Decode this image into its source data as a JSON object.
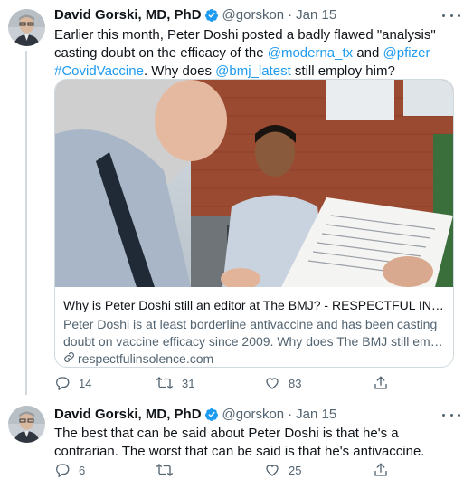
{
  "tweets": [
    {
      "author_name": "David Gorski, MD, PhD",
      "handle": "@gorskon",
      "separator": "·",
      "date": "Jan 15",
      "text_parts": {
        "p1": "Earlier this month, Peter Doshi posted a badly flawed \"analysis\" casting doubt on the efficacy of the ",
        "m1": "@moderna_tx",
        "p2": " and ",
        "m2": "@pfizer",
        "p3": " ",
        "h1": "#CovidVaccine",
        "p4": ". Why does ",
        "m3": "@bmj_latest",
        "p5": " still employ him?"
      },
      "card": {
        "title": "Why is Peter Doshi still an editor at The BMJ? - RESPECTFUL INSOLE...",
        "description_line1": "Peter Doshi is at least borderline antivaccine and has been casting",
        "description_line2": "doubt on vaccine efficacy since 2009. Why does The BMJ still emplo...",
        "domain": "respectfulinsolence.com"
      },
      "actions": {
        "replies": "14",
        "retweets": "31",
        "likes": "83"
      }
    },
    {
      "author_name": "David Gorski, MD, PhD",
      "handle": "@gorskon",
      "separator": "·",
      "date": "Jan 15",
      "text": "The best that can be said about Peter Doshi is that he's a contrarian. The worst that can be said is that he's antivaccine.",
      "actions": {
        "replies": "6",
        "retweets": "",
        "likes": "25"
      }
    }
  ],
  "colors": {
    "link": "#1d9bf0",
    "secondary_text": "#536471",
    "verified": "#1d9bf0",
    "border": "#cfd9de"
  },
  "icons": [
    "verified-badge-icon",
    "more-icon",
    "reply-icon",
    "retweet-icon",
    "like-icon",
    "share-icon",
    "link-icon"
  ]
}
